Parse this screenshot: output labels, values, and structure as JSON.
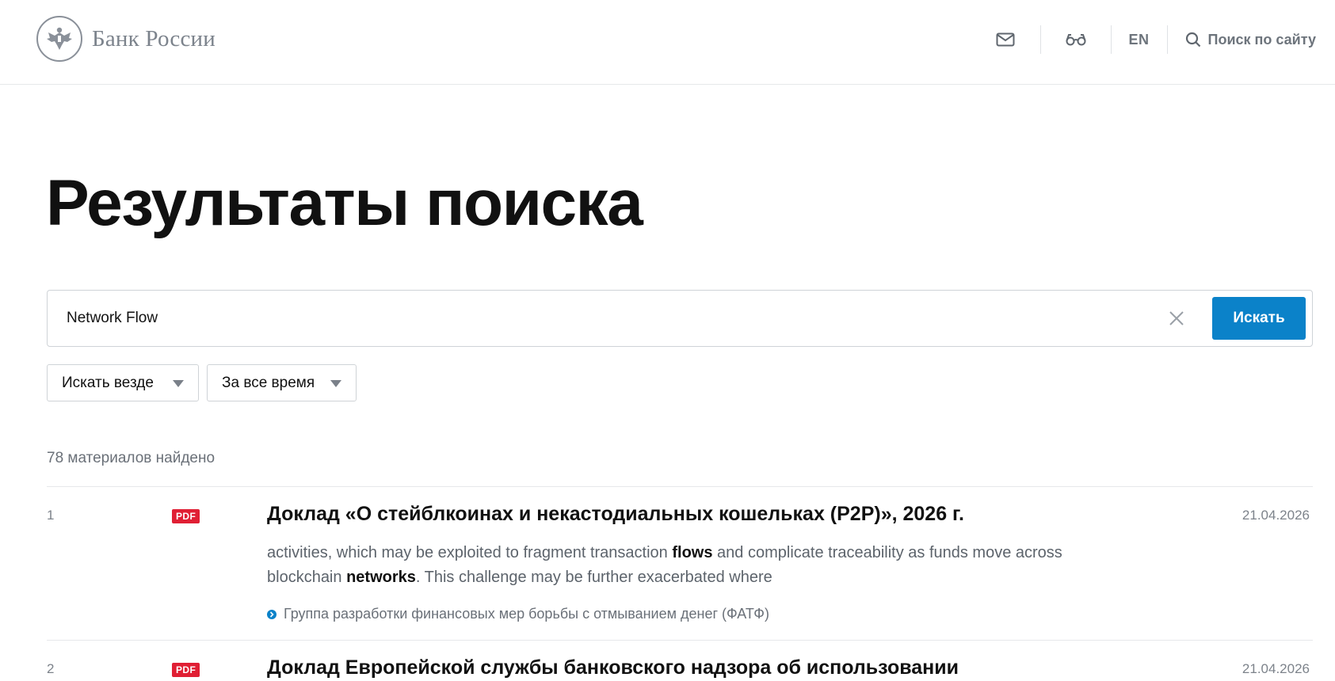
{
  "header": {
    "logo_text": "Банк России",
    "mail_icon": "mail-icon",
    "accessibility_icon": "glasses-icon",
    "lang_label": "EN",
    "search_label": "Поиск по сайту",
    "search_icon": "search-icon"
  },
  "page": {
    "title": "Результаты поиска"
  },
  "search": {
    "query": "Network Flow",
    "submit_label": "Искать",
    "clear_icon": "close-icon"
  },
  "filters": {
    "where": "Искать везде",
    "time": "За все время"
  },
  "results_count": "78 материалов найдено",
  "results": [
    {
      "number": "1",
      "badge": "PDF",
      "title": "Доклад «О стейблкоинах и некастодиальных кошельках (P2P)», 2026 г.",
      "date": "21.04.2026",
      "snippet_parts": [
        "activities, which may be exploited to fragment transaction ",
        "flows",
        " and complicate traceability as funds move across blockchain ",
        "networks",
        ". This challenge may be further exacerbated where"
      ],
      "source": "Группа разработки финансовых мер борьбы с отмыванием денег (ФАТФ)"
    },
    {
      "number": "2",
      "badge": "PDF",
      "title": "Доклад Европейской службы банковского надзора об использовании",
      "date": "21.04.2026"
    }
  ],
  "colors": {
    "accent": "#0b82c9",
    "pdf_badge": "#e01f34",
    "muted_text": "#6a7078"
  }
}
